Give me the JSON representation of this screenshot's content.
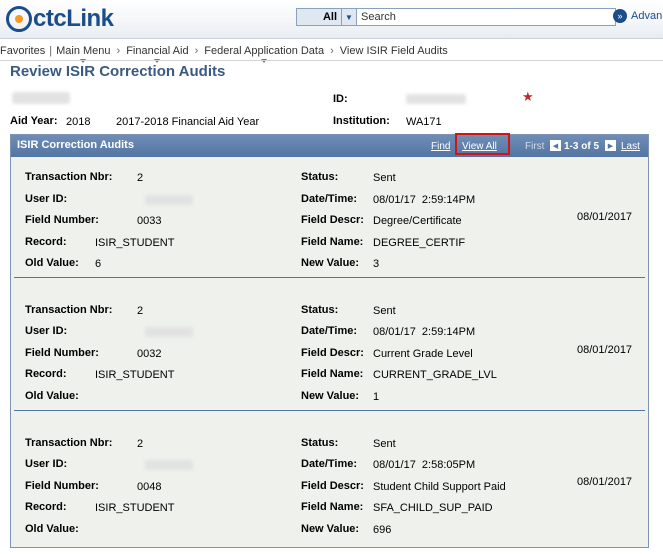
{
  "header": {
    "logo": {
      "prefix": "ctc",
      "suffix": "Link"
    },
    "search": {
      "scope": "All",
      "placeholder": "Search"
    },
    "advanced": "Advan"
  },
  "breadcrumb": [
    "Favorites",
    "Main Menu",
    "Financial Aid",
    "Federal Application Data",
    "View ISIR Field Audits"
  ],
  "page": {
    "title": "Review ISIR Correction Audits",
    "id_label": "ID:",
    "aid_year_label": "Aid Year:",
    "aid_year_value": "2018",
    "aid_year_desc": "2017-2018 Financial Aid Year",
    "institution_label": "Institution:",
    "institution_value": "WA171"
  },
  "grid": {
    "title": "ISIR Correction Audits",
    "find": "Find",
    "view_all": "View All",
    "first": "First",
    "range": "1-3 of 5",
    "last": "Last",
    "labels": {
      "transaction": "Transaction Nbr:",
      "user": "User ID:",
      "field_number": "Field Number:",
      "record": "Record:",
      "old_value": "Old Value:",
      "status": "Status:",
      "datetime": "Date/Time:",
      "field_descr": "Field Descr:",
      "field_name": "Field Name:",
      "new_value": "New Value:"
    },
    "rows": [
      {
        "transaction": "2",
        "field_number": "0033",
        "record": "ISIR_STUDENT",
        "old_value": "6",
        "status": "Sent",
        "datetime": "08/01/17  2:59:14PM",
        "field_descr": "Degree/Certificate",
        "field_name": "DEGREE_CERTIF",
        "new_value": "3",
        "date": "08/01/2017"
      },
      {
        "transaction": "2",
        "field_number": "0032",
        "record": "ISIR_STUDENT",
        "old_value": "",
        "status": "Sent",
        "datetime": "08/01/17  2:59:14PM",
        "field_descr": "Current Grade Level",
        "field_name": "CURRENT_GRADE_LVL",
        "new_value": "1",
        "date": "08/01/2017"
      },
      {
        "transaction": "2",
        "field_number": "0048",
        "record": "ISIR_STUDENT",
        "old_value": "",
        "status": "Sent",
        "datetime": "08/01/17  2:58:05PM",
        "field_descr": "Student Child Support Paid",
        "field_name": "SFA_CHILD_SUP_PAID",
        "new_value": "696",
        "date": "08/01/2017"
      }
    ]
  },
  "colors": {
    "brand": "#1b4d8a",
    "grid_header": "#5375a3",
    "highlight": "#d11414",
    "title": "#3b5a82"
  }
}
